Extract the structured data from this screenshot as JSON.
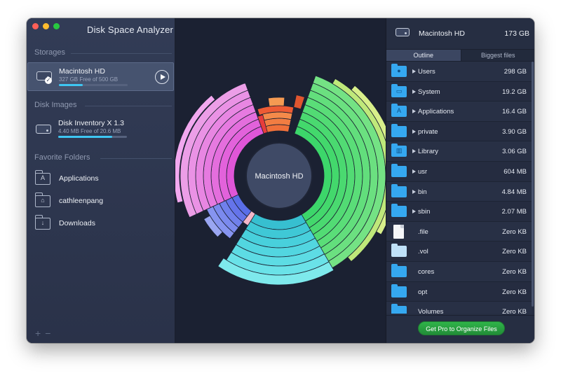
{
  "app": {
    "title": "Disk Space Analyzer"
  },
  "sidebar": {
    "storages_label": "Storages",
    "storage": {
      "name": "Macintosh HD",
      "detail": "327 GB Free of 500 GB",
      "used_fraction": 0.346
    },
    "disk_images_label": "Disk Images",
    "disk_image": {
      "name": "Disk Inventory X 1.3",
      "detail": "4.40 MB Free of 20.6 MB",
      "used_fraction": 0.786
    },
    "favorites_label": "Favorite Folders",
    "favorites": [
      {
        "label": "Applications",
        "icon": "applications-folder-icon"
      },
      {
        "label": "cathleenpang",
        "icon": "home-folder-icon"
      },
      {
        "label": "Downloads",
        "icon": "downloads-folder-icon"
      }
    ],
    "add_symbol": "+",
    "remove_symbol": "−"
  },
  "center": {
    "label": "Macintosh HD"
  },
  "panel": {
    "drive_name": "Macintosh HD",
    "drive_size": "173 GB",
    "tabs": [
      "Outline",
      "Biggest files"
    ],
    "active_tab": 0,
    "items": [
      {
        "name": "Users",
        "size": "298 GB",
        "icon": "users-folder-icon",
        "expandable": true
      },
      {
        "name": "System",
        "size": "19.2 GB",
        "icon": "system-folder-icon",
        "expandable": true
      },
      {
        "name": "Applications",
        "size": "16.4 GB",
        "icon": "applications-folder-icon",
        "expandable": true
      },
      {
        "name": "private",
        "size": "3.90 GB",
        "icon": "folder-icon",
        "expandable": true
      },
      {
        "name": "Library",
        "size": "3.06 GB",
        "icon": "library-folder-icon",
        "expandable": true
      },
      {
        "name": "usr",
        "size": "604 MB",
        "icon": "folder-icon",
        "expandable": true
      },
      {
        "name": "bin",
        "size": "4.84 MB",
        "icon": "folder-icon",
        "expandable": true
      },
      {
        "name": "sbin",
        "size": "2.07 MB",
        "icon": "folder-icon",
        "expandable": true
      },
      {
        "name": ".file",
        "size": "Zero KB",
        "icon": "document-icon",
        "expandable": false
      },
      {
        "name": ".vol",
        "size": "Zero KB",
        "icon": "pale-folder-icon",
        "expandable": false
      },
      {
        "name": "cores",
        "size": "Zero KB",
        "icon": "folder-icon",
        "expandable": false
      },
      {
        "name": "opt",
        "size": "Zero KB",
        "icon": "folder-icon",
        "expandable": false
      },
      {
        "name": "Volumes",
        "size": "Zero KB",
        "icon": "folder-icon",
        "expandable": false
      }
    ],
    "pro_button": "Get Pro to Organize Files"
  }
}
